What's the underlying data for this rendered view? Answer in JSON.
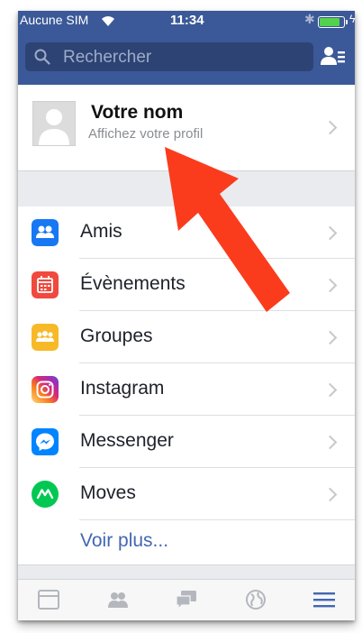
{
  "status_bar": {
    "carrier": "Aucune SIM",
    "time": "11:34",
    "battery_level": 0.9,
    "battery_color": "#52d24f"
  },
  "header": {
    "color": "#3b5998",
    "search_placeholder": "Rechercher",
    "contacts_icon": "contacts-icon"
  },
  "profile": {
    "name": "Votre nom",
    "subtitle": "Affichez votre profil"
  },
  "menu": {
    "items": [
      {
        "label": "Amis",
        "icon": "friends-icon",
        "color": "#1877f2"
      },
      {
        "label": "Évènements",
        "icon": "calendar-icon",
        "color": "#f0493e"
      },
      {
        "label": "Groupes",
        "icon": "groups-icon",
        "color": "#f7b928"
      },
      {
        "label": "Instagram",
        "icon": "instagram-icon",
        "color": "#c13584"
      },
      {
        "label": "Messenger",
        "icon": "messenger-icon",
        "color": "#0084ff"
      },
      {
        "label": "Moves",
        "icon": "moves-icon",
        "color": "#00c853"
      }
    ],
    "more_label": "Voir plus..."
  },
  "tabbar": {
    "tabs": [
      {
        "icon": "news-feed-icon"
      },
      {
        "icon": "friend-requests-icon"
      },
      {
        "icon": "messages-icon"
      },
      {
        "icon": "notifications-globe-icon"
      },
      {
        "icon": "menu-icon",
        "active": true
      }
    ],
    "active_color": "#4267b2",
    "inactive_color": "#b4b7bd"
  },
  "annotation": {
    "arrow_color": "#fa3c1d"
  }
}
